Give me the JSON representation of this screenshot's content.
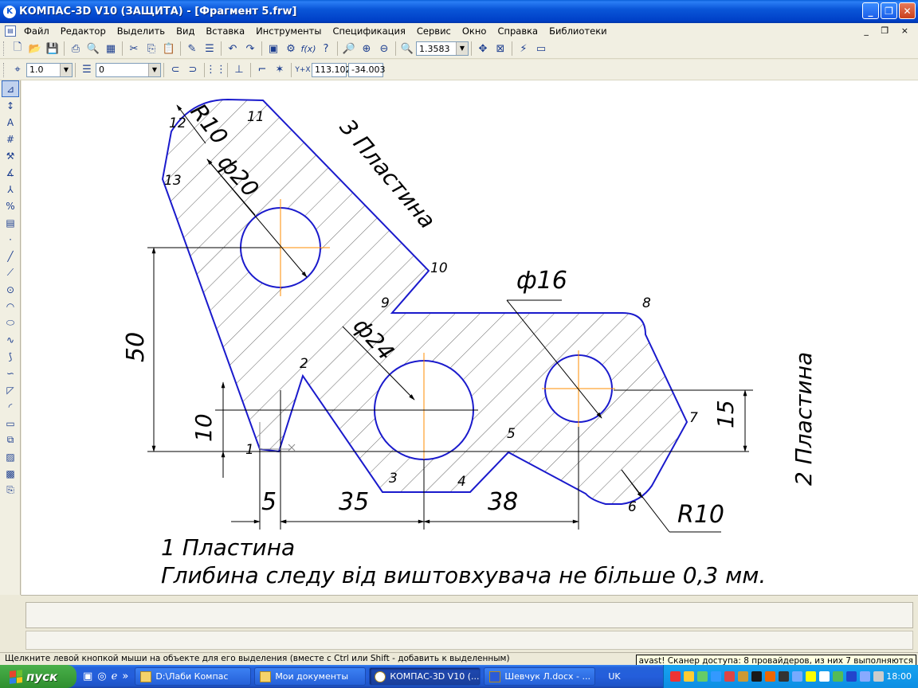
{
  "window": {
    "title": "КОМПАС-3D V10 (ЗАЩИТА) - [Фрагмент 5.frw]",
    "minimize": "_",
    "maximize": "❐",
    "close": "✕"
  },
  "menu": {
    "items": [
      "Файл",
      "Редактор",
      "Выделить",
      "Вид",
      "Вставка",
      "Инструменты",
      "Спецификация",
      "Сервис",
      "Окно",
      "Справка",
      "Библиотеки"
    ],
    "mdi_controls": "_ ❐ ×"
  },
  "toolbar1": {
    "zoom_value": "1.3583"
  },
  "toolbar2": {
    "line_scale": "1.0",
    "layer": "0",
    "coord_x": "113.102",
    "coord_y": "-34.003"
  },
  "drawing": {
    "plate1_label": "1 Пластина",
    "plate2_label": "2 Пластина",
    "plate3_label": "3 Пластина",
    "note": "Глибина следу від виштовхувача не більше 0,3 мм.",
    "dim_50": "50",
    "dim_10": "10",
    "dim_15": "15",
    "dim_5": "5",
    "dim_35": "35",
    "dim_38": "38",
    "dim_phi20": "ф20",
    "dim_phi24": "ф24",
    "dim_phi16": "ф16",
    "dim_r10_top": "R10",
    "dim_r10_bottom": "R10",
    "points": [
      "1",
      "2",
      "3",
      "4",
      "5",
      "6",
      "7",
      "8",
      "9",
      "10",
      "11",
      "12",
      "13"
    ]
  },
  "statusbar": {
    "hint": "Щелкните левой кнопкой мыши на объекте для его выделения (вместе с Ctrl или Shift - добавить к выделенным)"
  },
  "taskbar": {
    "start": "пуск",
    "tasks": [
      "D:\\Лаби Компас",
      "Мои документы",
      "КОМПАС-3D V10 (...",
      "Шевчук Л.docx - ..."
    ],
    "lang": "UK",
    "clock": "18:00",
    "balloon": "avast! Сканер доступа: 8 провайдеров, из них 7 выполняются"
  }
}
